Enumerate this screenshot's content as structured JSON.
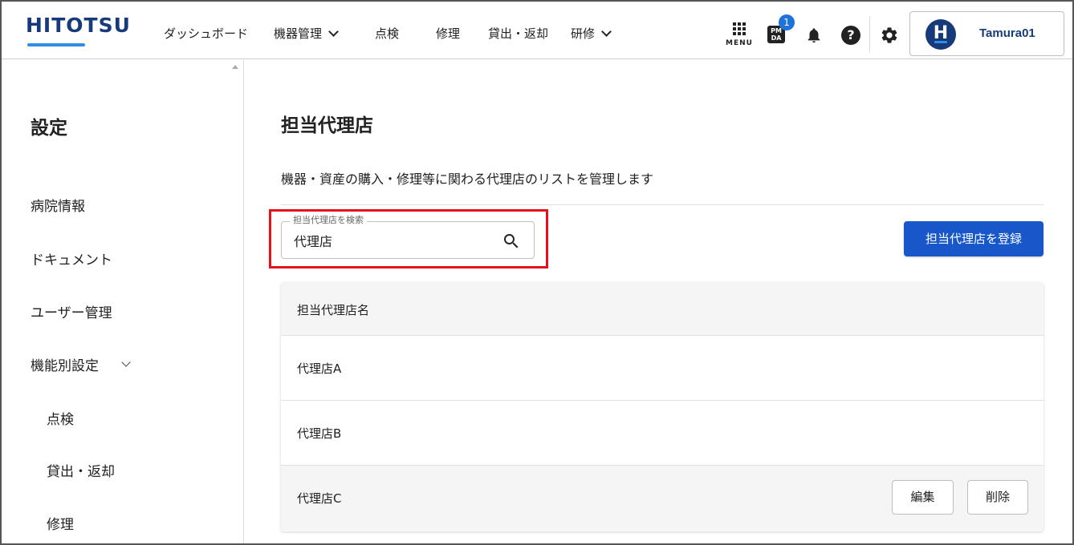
{
  "header": {
    "logo": "HITOTSU",
    "nav": [
      {
        "label": "ダッシュボード",
        "dropdown": false
      },
      {
        "label": "機器管理",
        "dropdown": true
      },
      {
        "label": "点検",
        "dropdown": false
      },
      {
        "label": "修理",
        "dropdown": false
      },
      {
        "label": "貸出・返却",
        "dropdown": false
      },
      {
        "label": "研修",
        "dropdown": true
      }
    ],
    "menu_label": "MENU",
    "pmda_icon_text": "PM DA",
    "pmda_badge_count": "1",
    "help_glyph": "?",
    "user": {
      "avatar_letter": "H",
      "name": "Tamura01"
    }
  },
  "sidebar": {
    "title": "設定",
    "items": [
      {
        "label": "病院情報"
      },
      {
        "label": "ドキュメント"
      },
      {
        "label": "ユーザー管理"
      },
      {
        "label": "機能別設定",
        "expandable": true
      },
      {
        "label": "点検",
        "sub": true
      },
      {
        "label": "貸出・返却",
        "sub": true
      },
      {
        "label": "修理",
        "sub": true
      }
    ]
  },
  "main": {
    "title": "担当代理店",
    "description": "機器・資産の購入・修理等に関わる代理店のリストを管理します",
    "search": {
      "legend": "担当代理店を検索",
      "value": "代理店"
    },
    "register_button": "担当代理店を登録",
    "table": {
      "header": "担当代理店名",
      "rows": [
        {
          "name": "代理店A"
        },
        {
          "name": "代理店B"
        },
        {
          "name": "代理店C"
        }
      ],
      "edit_label": "編集",
      "delete_label": "削除"
    }
  },
  "colors": {
    "brand_navy": "#173a7a",
    "accent_blue": "#1757c9",
    "badge_blue": "#1e73d8",
    "highlight_red": "#e5121b"
  }
}
